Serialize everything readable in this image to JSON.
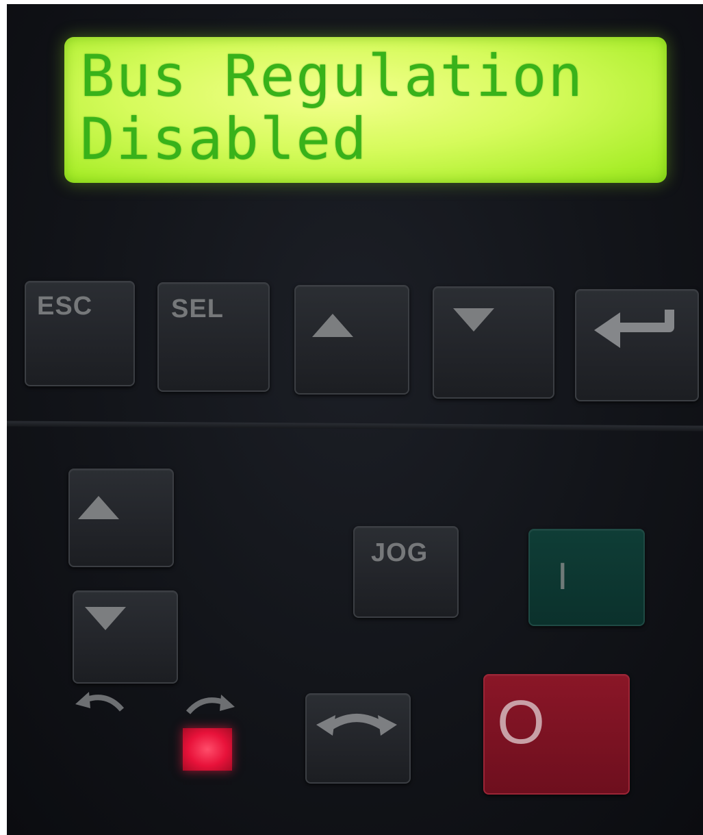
{
  "display": {
    "line1": "Bus Regulation",
    "line2": "Disabled"
  },
  "keypad": {
    "esc_label": "ESC",
    "sel_label": "SEL",
    "up_icon": "up-triangle-icon",
    "down_icon": "down-triangle-icon",
    "enter_icon": "enter-arrow-icon",
    "speed_up_icon": "up-triangle-icon",
    "speed_down_icon": "down-triangle-icon",
    "jog_label": "JOG",
    "start_label": "I",
    "stop_label": "O",
    "reverse_icon": "curved-arrow-left-icon",
    "forward_icon": "curved-arrow-right-icon",
    "direction_icon": "curved-double-arrow-icon"
  },
  "colors": {
    "lcd_background": "#c8f84a",
    "lcd_text": "#38b21a",
    "start_key": "#0d3a34",
    "stop_key": "#7d1323",
    "forward_led": "#ee1a40"
  }
}
